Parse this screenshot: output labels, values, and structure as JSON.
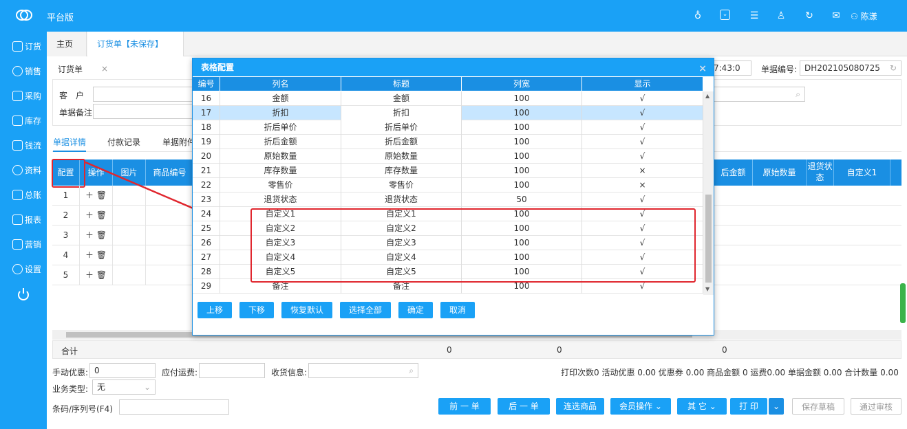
{
  "app": {
    "brand": "平台版",
    "user": "陈漾"
  },
  "sidebar": {
    "items": [
      {
        "label": "订货"
      },
      {
        "label": "销售"
      },
      {
        "label": "采购"
      },
      {
        "label": "库存"
      },
      {
        "label": "钱流"
      },
      {
        "label": "资料"
      },
      {
        "label": "总账"
      },
      {
        "label": "报表"
      },
      {
        "label": "营销"
      },
      {
        "label": "设置"
      }
    ]
  },
  "tabs": [
    {
      "label": "主页"
    },
    {
      "label": "订货单【未保存】"
    }
  ],
  "form": {
    "title": "订货单",
    "customer_label": "客　户",
    "remark_label": "单据备注",
    "doc_no_label": "单据编号:",
    "doc_no_value": "DH202105080725",
    "time_value": "7:43:0"
  },
  "subtabs": [
    {
      "label": "单据详情"
    },
    {
      "label": "付款记录"
    },
    {
      "label": "单据附件"
    }
  ],
  "grid": {
    "left_headers": [
      "配置",
      "操作",
      "图片",
      "商品编号"
    ],
    "right_headers": [
      "后金额",
      "原始数量",
      "退货状态",
      "自定义1"
    ],
    "rows": [
      "1",
      "2",
      "3",
      "4",
      "5"
    ],
    "summary_label": "合计",
    "summary_values": [
      "0",
      "0",
      "0"
    ]
  },
  "modal": {
    "title": "表格配置",
    "columns": [
      "编号",
      "列名",
      "标题",
      "列宽",
      "显示"
    ],
    "rows": [
      {
        "no": "16",
        "name": "金额",
        "title": "金额",
        "width": "100",
        "show": "√"
      },
      {
        "no": "17",
        "name": "折扣",
        "title": "折扣",
        "width": "100",
        "show": "√"
      },
      {
        "no": "18",
        "name": "折后单价",
        "title": "折后单价",
        "width": "100",
        "show": "√"
      },
      {
        "no": "19",
        "name": "折后金额",
        "title": "折后金额",
        "width": "100",
        "show": "√"
      },
      {
        "no": "20",
        "name": "原始数量",
        "title": "原始数量",
        "width": "100",
        "show": "√"
      },
      {
        "no": "21",
        "name": "库存数量",
        "title": "库存数量",
        "width": "100",
        "show": "×"
      },
      {
        "no": "22",
        "name": "零售价",
        "title": "零售价",
        "width": "100",
        "show": "×"
      },
      {
        "no": "23",
        "name": "退货状态",
        "title": "退货状态",
        "width": "50",
        "show": "√"
      },
      {
        "no": "24",
        "name": "自定义1",
        "title": "自定义1",
        "width": "100",
        "show": "√"
      },
      {
        "no": "25",
        "name": "自定义2",
        "title": "自定义2",
        "width": "100",
        "show": "√"
      },
      {
        "no": "26",
        "name": "自定义3",
        "title": "自定义3",
        "width": "100",
        "show": "√"
      },
      {
        "no": "27",
        "name": "自定义4",
        "title": "自定义4",
        "width": "100",
        "show": "√"
      },
      {
        "no": "28",
        "name": "自定义5",
        "title": "自定义5",
        "width": "100",
        "show": "√"
      },
      {
        "no": "29",
        "name": "备注",
        "title": "备注",
        "width": "100",
        "show": "√"
      }
    ],
    "buttons": [
      "上移",
      "下移",
      "恢复默认",
      "选择全部",
      "确定",
      "取消"
    ]
  },
  "footer": {
    "discount_label": "手动优惠:",
    "discount_value": "0",
    "freight_label": "应付运费:",
    "receive_label": "收货信息:",
    "biztype_label": "业务类型:",
    "biztype_value": "无",
    "barcode_label": "条码/序列号(F4)",
    "stats": "打印次数0  活动优惠 0.00  优惠券 0.00  商品金额 0  运费0.00  单据金额 0.00  合计数量 0.00",
    "buttons": [
      "前 一 单",
      "后 一 单",
      "连选商品",
      "会员操作",
      "其 它",
      "打 印"
    ],
    "draft": "保存草稿",
    "approve": "通过审核"
  },
  "colors": {
    "primary": "#1aa1f6",
    "highlight": "#e0262e"
  }
}
